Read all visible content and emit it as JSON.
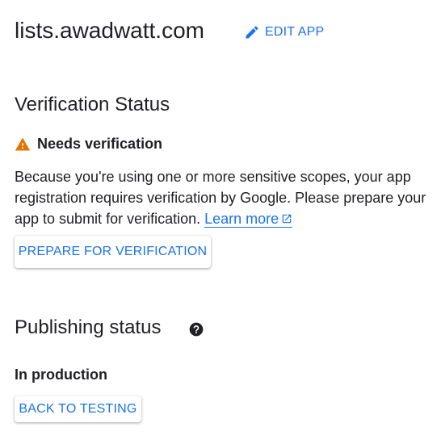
{
  "header": {
    "app_name": "lists.awadwatt.com",
    "edit_label": "EDIT APP",
    "edit_icon": "pencil-icon"
  },
  "verification": {
    "title": "Verification Status",
    "status_label": "Needs verification",
    "status_icon": "warning-icon",
    "status_color": "#e37400",
    "description": "Because you're using one or more sensitive scopes, your app registration requires verification by Google. Please prepare your app to submit for verification.",
    "learn_more_label": "Learn more",
    "learn_more_icon": "open-in-new-icon",
    "prepare_button": "PREPARE FOR VERIFICATION"
  },
  "publishing": {
    "title": "Publishing status",
    "help_icon": "help-icon",
    "status_label": "In production",
    "back_button": "BACK TO TESTING"
  },
  "colors": {
    "accent": "#1a73e8",
    "text": "#202124",
    "warning": "#e37400"
  }
}
